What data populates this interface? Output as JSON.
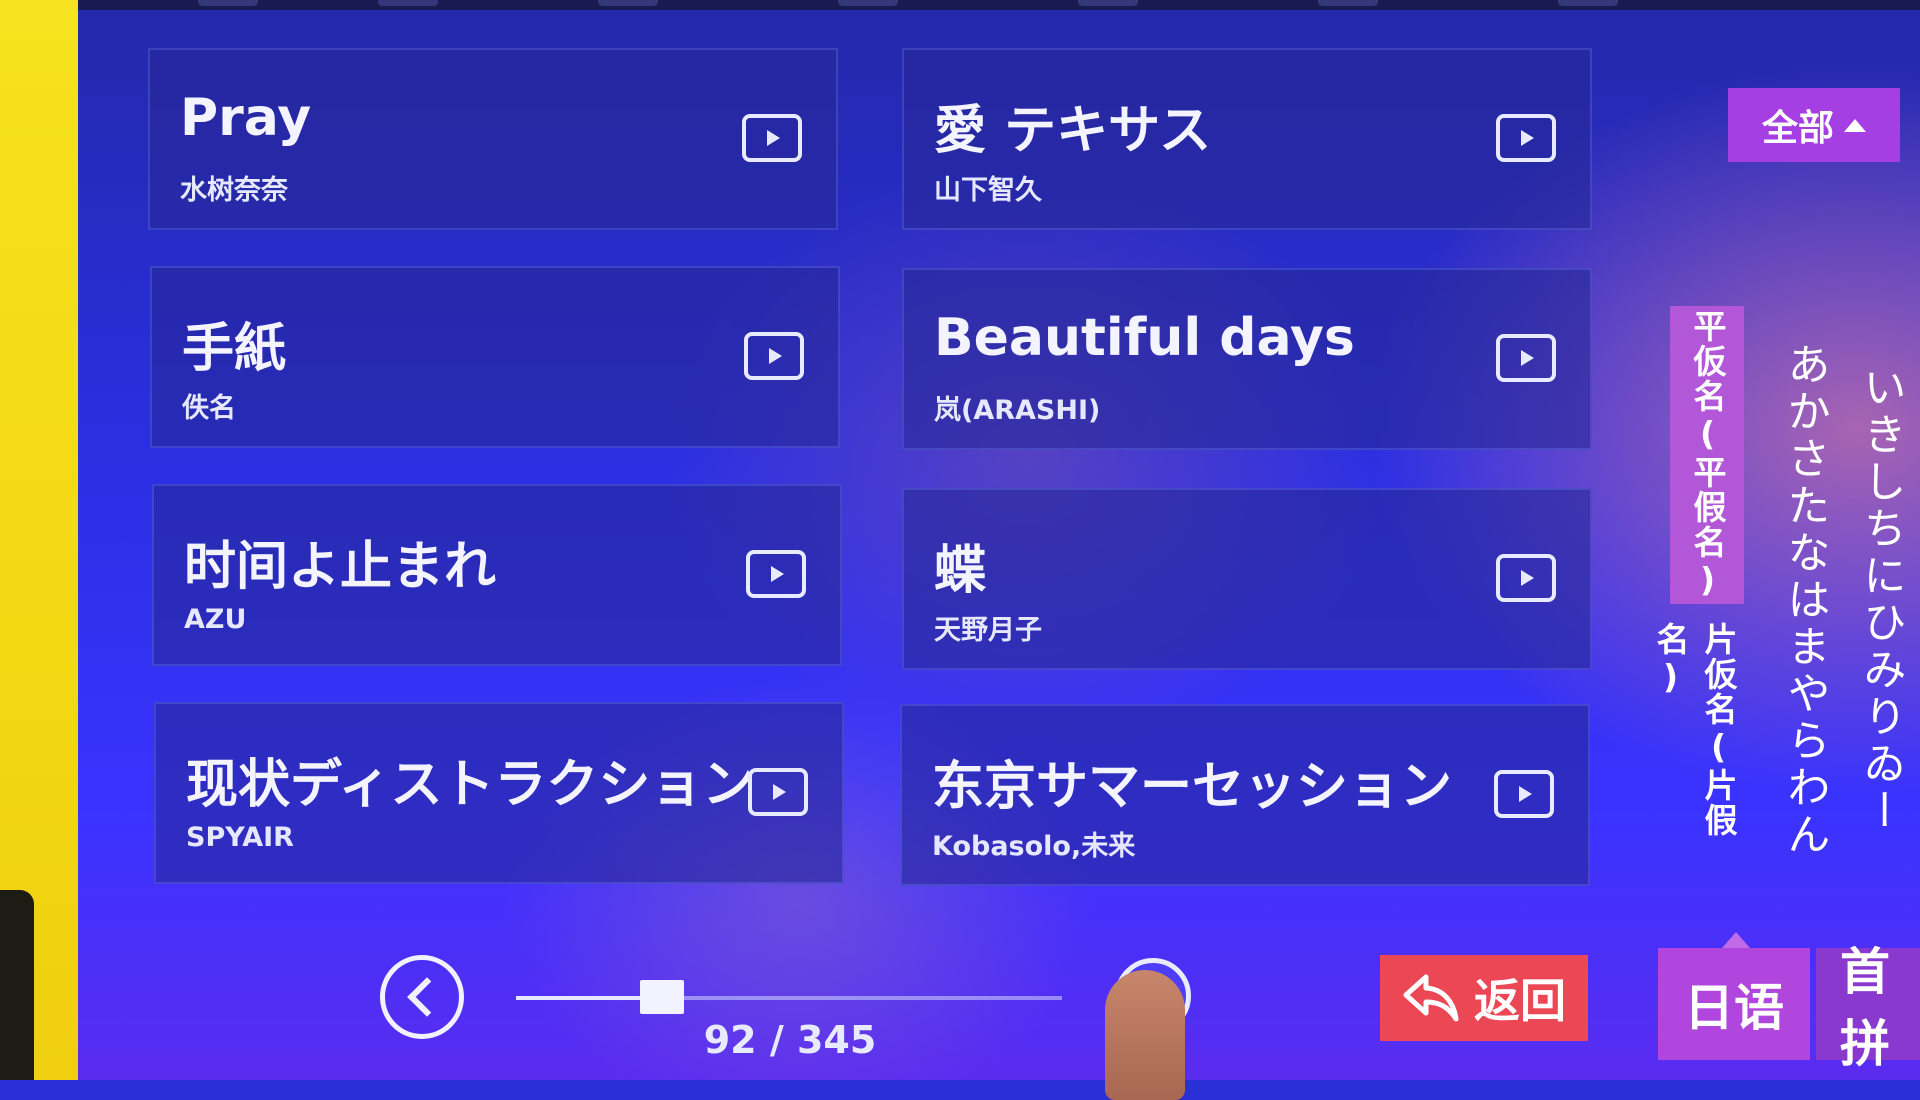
{
  "songs": [
    {
      "title": "Pray",
      "artist": "水树奈奈"
    },
    {
      "title": "愛 テキサス",
      "artist": "山下智久"
    },
    {
      "title": "手紙",
      "artist": "佚名"
    },
    {
      "title": "Beautiful days",
      "artist": "岚(ARASHI)"
    },
    {
      "title": "时间よ止まれ",
      "artist": "AZU"
    },
    {
      "title": "蝶",
      "artist": "天野月子"
    },
    {
      "title": "现状ディストラクション",
      "artist": "SPYAIR"
    },
    {
      "title": "东京サマーセッション",
      "artist": "Kobasolo,未来"
    }
  ],
  "filter": {
    "label": "全部"
  },
  "kana": {
    "hiragana_label": "平仮名(平假名)",
    "katakana_label": "片仮名(片假名)",
    "column_1": "あかさたなはまやらわん",
    "column_2": "いきしちにひみりゐー"
  },
  "pager": {
    "label": "92 / 345",
    "current": 92,
    "total": 345
  },
  "buttons": {
    "back": "返回"
  },
  "tabs": {
    "japanese": "日语",
    "first": "首拼"
  },
  "colors": {
    "accent_purple": "#b046de",
    "back_red": "#ec4755",
    "background_blue": "#2a2fd6"
  }
}
